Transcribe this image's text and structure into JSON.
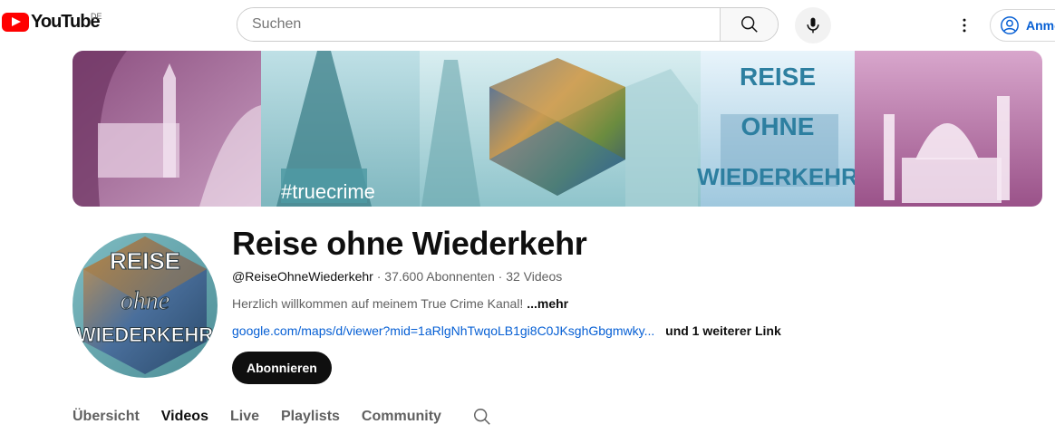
{
  "header": {
    "logo_text": "YouTube",
    "country_code": "DE",
    "search_placeholder": "Suchen",
    "sign_in_label": "Anmelden",
    "colors": {
      "brand_red": "#ff0000",
      "link_blue": "#065fd4"
    }
  },
  "banner": {
    "tag_text": "#truecrime",
    "title_lines": [
      "REISE",
      "OHNE",
      "WIEDERKEHR"
    ]
  },
  "channel": {
    "avatar_lines": [
      "REISE",
      "ohne",
      "WIEDERKEHR"
    ],
    "name": "Reise ohne Wiederkehr",
    "handle": "@ReiseOhneWiederkehr",
    "separator": " · ",
    "subscribers": "37.600 Abonnenten",
    "videos": "32 Videos",
    "description": "Herzlich willkommen auf meinem True Crime Kanal! ",
    "more_label": "...mehr",
    "link_text": "google.com/maps/d/viewer?mid=1aRlgNhTwqoLB1gi8C0JKsghGbgmwky...",
    "more_links": "und 1 weiterer Link",
    "subscribe_label": "Abonnieren"
  },
  "tabs": {
    "overview": "Übersicht",
    "videos": "Videos",
    "live": "Live",
    "playlists": "Playlists",
    "community": "Community",
    "active": "videos"
  },
  "icons": [
    "search-icon",
    "microphone-icon",
    "more-vert-icon",
    "account-circle-icon",
    "youtube-logo-icon",
    "tab-search-icon"
  ]
}
